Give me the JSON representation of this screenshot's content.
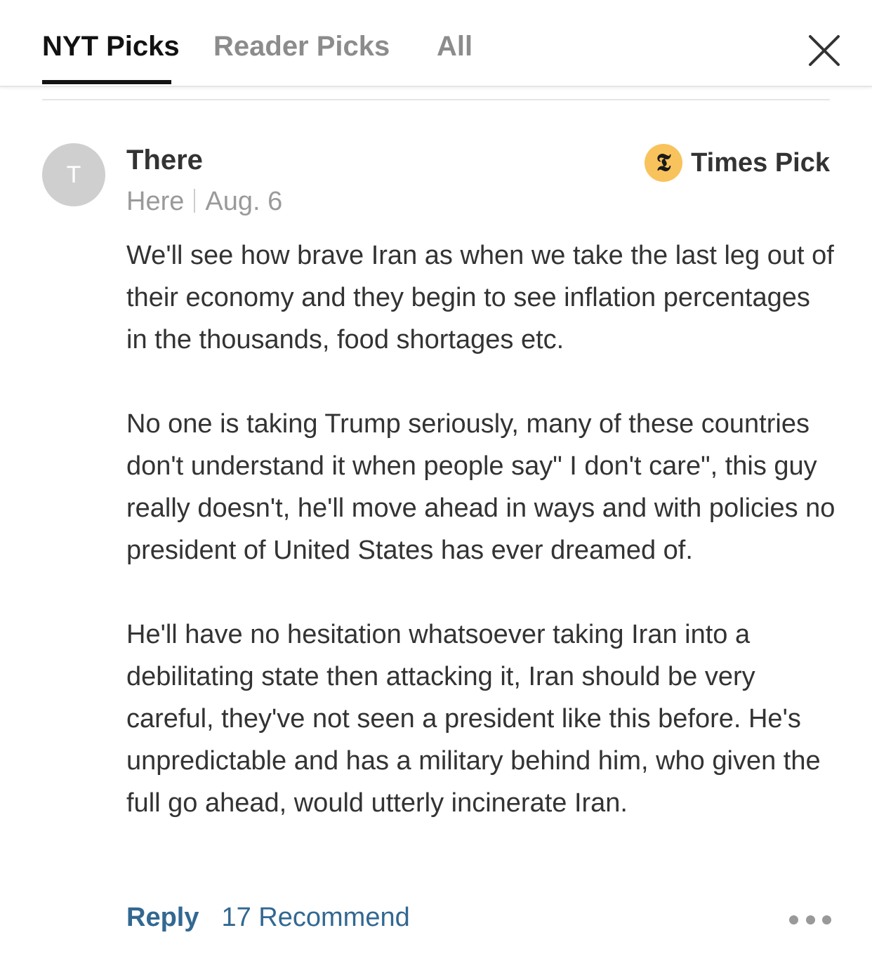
{
  "tabs": [
    {
      "label": "NYT Picks",
      "active": true
    },
    {
      "label": "Reader Picks",
      "active": false
    },
    {
      "label": "All",
      "active": false
    }
  ],
  "close_icon": "close-x-icon",
  "comment": {
    "avatar_initial": "T",
    "author": "There",
    "location": "Here",
    "date": "Aug. 6",
    "badge": {
      "icon": "nyt-logo-icon",
      "glyph": "𝕿",
      "label": "Times Pick",
      "color": "#f8c35c"
    },
    "paragraphs": [
      "We'll see how brave Iran as when we take the last leg out of their economy and they begin to see inflation percentages in the thousands, food shortages etc.",
      "No one is taking Trump seriously, many of these countries don't understand it when people say\" I don't care\", this guy really doesn't, he'll move ahead in ways and with policies no president of United States has ever dreamed of.",
      "He'll have no hesitation whatsoever taking Iran into a debilitating state then attacking it, Iran should be very careful, they've not seen a president like this before. He's unpredictable and has a military behind him, who given the full go ahead, would utterly incinerate Iran."
    ],
    "actions": {
      "reply_label": "Reply",
      "recommend_label": "17 Recommend",
      "more_icon": "more-dots-icon"
    }
  },
  "colors": {
    "link_blue": "#326891",
    "active_tab": "#121212",
    "inactive_tab": "#8c8c8c"
  }
}
